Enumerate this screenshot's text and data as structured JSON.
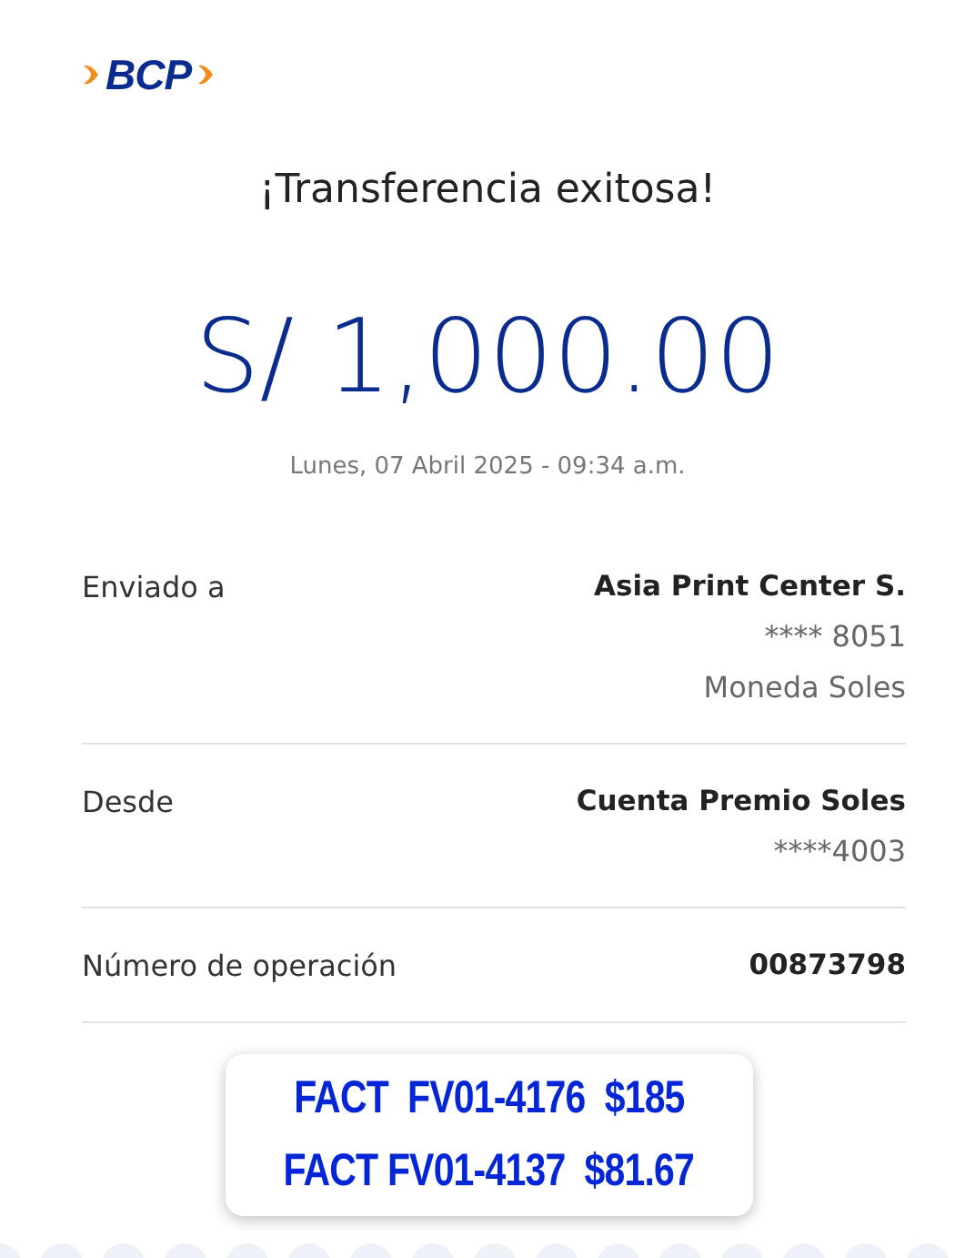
{
  "logo": {
    "text": "BCP"
  },
  "title": "¡Transferencia exitosa!",
  "amount": "S/ 1,000.00",
  "datetime": "Lunes, 07 Abril 2025 - 09:34 a.m.",
  "details": [
    {
      "label": "Enviado a",
      "values": [
        {
          "text": "Asia Print Center S.",
          "bold": true
        },
        {
          "text": "**** 8051",
          "bold": false
        },
        {
          "text": "Moneda Soles",
          "bold": false
        }
      ]
    },
    {
      "label": "Desde",
      "values": [
        {
          "text": "Cuenta Premio Soles",
          "bold": true
        },
        {
          "text": "****4003",
          "bold": false
        }
      ]
    },
    {
      "label": "Número de operación",
      "values": [
        {
          "text": "00873798",
          "bold": true
        }
      ]
    }
  ],
  "note": {
    "lines": [
      "FACT  FV01-4176  $185",
      "FACT FV01-4137  $81.67"
    ]
  }
}
